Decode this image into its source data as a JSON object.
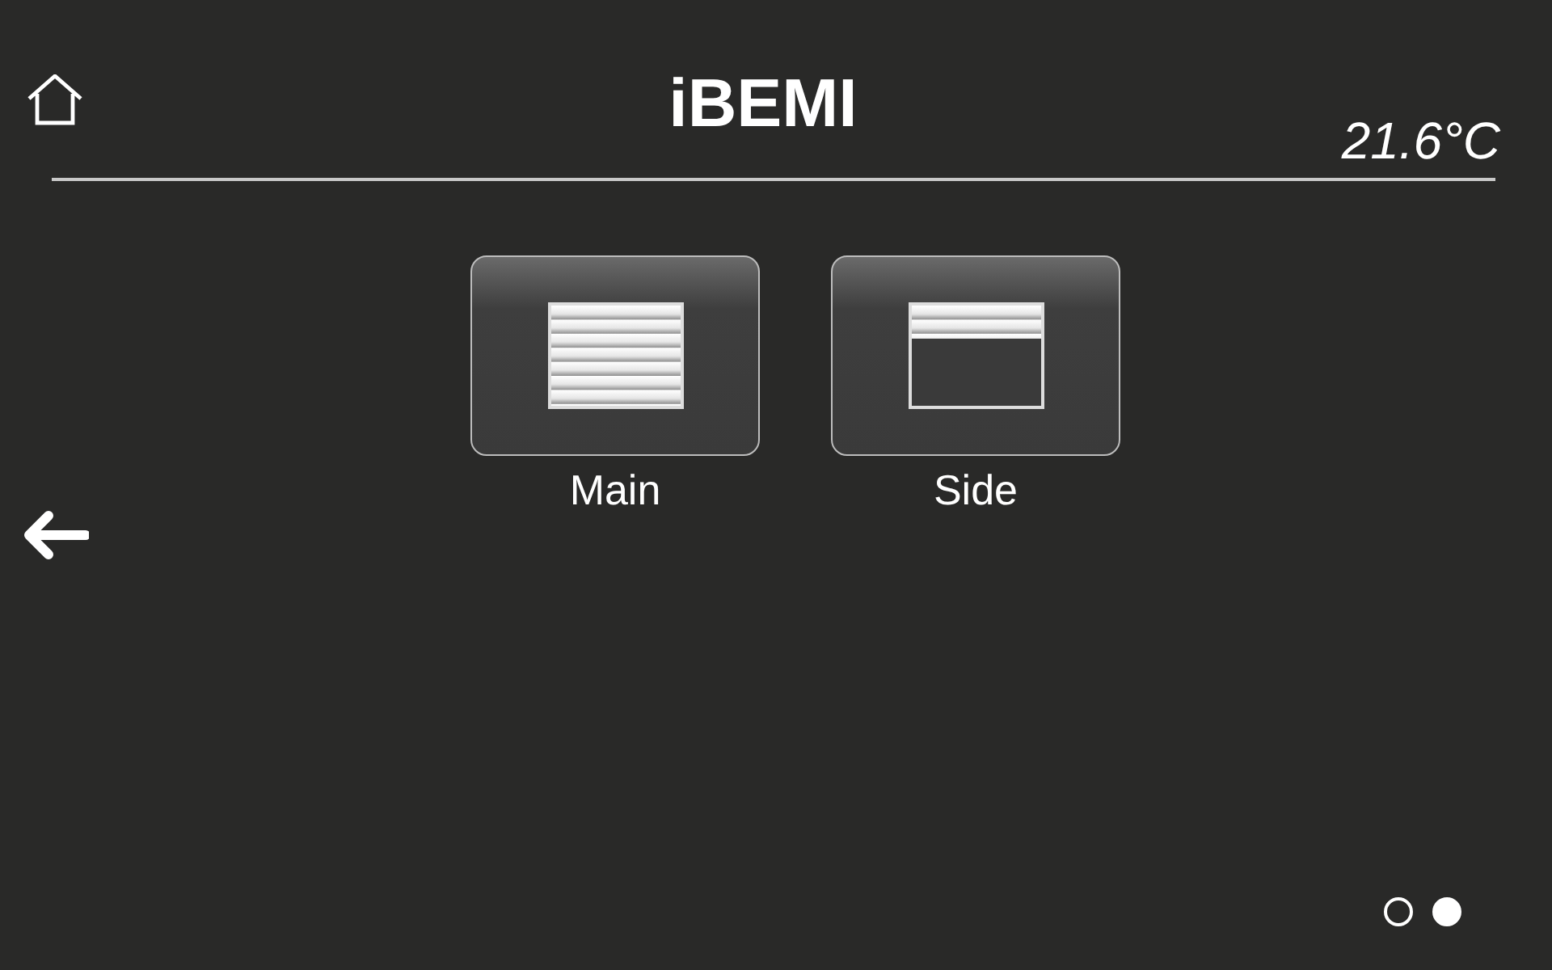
{
  "header": {
    "title": "iBEMI",
    "temperature": "21.6°C"
  },
  "shutters": [
    {
      "label": "Main",
      "kind": "closed"
    },
    {
      "label": "Side",
      "kind": "partial"
    }
  ],
  "pages": [
    {
      "selected": false
    },
    {
      "selected": true
    }
  ]
}
